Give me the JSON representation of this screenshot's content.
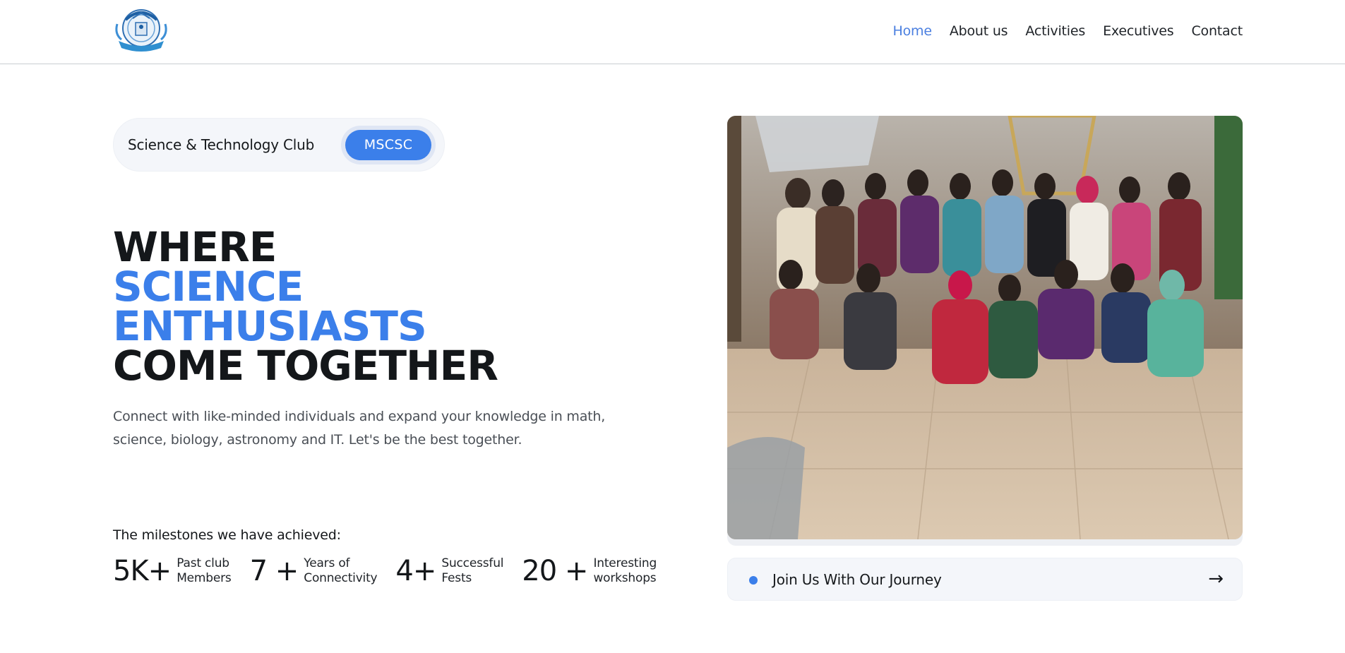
{
  "nav": {
    "items": [
      "Home",
      "About us",
      "Activities",
      "Executives",
      "Contact"
    ],
    "active": "Home"
  },
  "badge": {
    "text": "Science & Technology Club",
    "pill": "MSCSC"
  },
  "headline": {
    "line1": "WHERE",
    "line2": "SCIENCE",
    "line3": "ENTHUSIASTS",
    "line4": "COME TOGETHER"
  },
  "description": "Connect with like-minded individuals and expand your knowledge in math, science, biology, astronomy and IT. Let's be the best together.",
  "milestones": {
    "title": "The milestones we have achieved:",
    "stats": [
      {
        "number": "5K+",
        "label_line1": "Past club",
        "label_line2": "Members"
      },
      {
        "number": "7 +",
        "label_line1": "Years of",
        "label_line2": "Connectivity"
      },
      {
        "number": "4+",
        "label_line1": "Successful",
        "label_line2": "Fests"
      },
      {
        "number": "20 +",
        "label_line1": "Interesting",
        "label_line2": "workshops"
      }
    ]
  },
  "join": {
    "text": "Join Us With Our Journey",
    "arrow_icon": "arrow-right-icon"
  },
  "colors": {
    "accent": "#3b7fea",
    "nav_active": "#4a7fe0",
    "text_dark": "#14171a",
    "text_muted": "#4a4f56"
  }
}
